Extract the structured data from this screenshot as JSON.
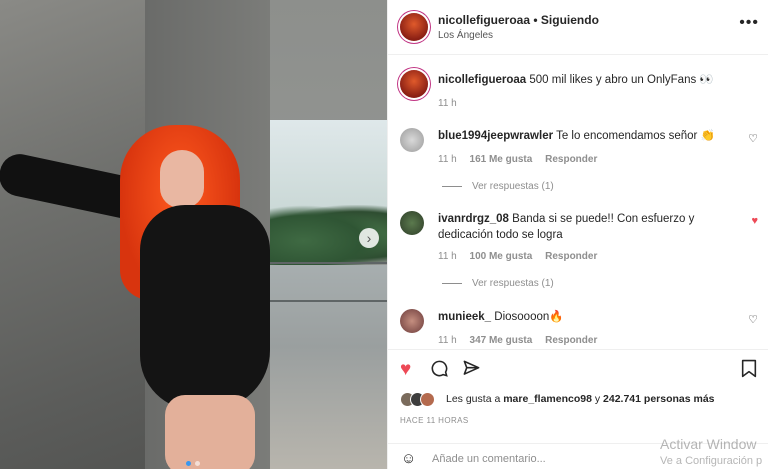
{
  "post": {
    "username": "nicollefigueroaa",
    "separator": "•",
    "follow_status": "Siguiendo",
    "location": "Los Ángeles",
    "more_icon": "more-horizontal-icon",
    "carousel_next_icon": "chevron-right-icon"
  },
  "caption": {
    "username": "nicollefigueroaa",
    "text": "500 mil likes y abro un OnlyFans 👀",
    "time": "11 h"
  },
  "comments": [
    {
      "username": "blue1994jeepwrawler",
      "text": "Te lo encomendamos señor 👏",
      "time": "11 h",
      "likes": "161 Me gusta",
      "reply": "Responder",
      "view_replies": "Ver respuestas (1)",
      "liked": false
    },
    {
      "username": "ivanrdrgz_08",
      "text": "Banda si se puede!! Con esfuerzo y dedicación todo se logra",
      "time": "11 h",
      "likes": "100 Me gusta",
      "reply": "Responder",
      "view_replies": "Ver respuestas (1)",
      "liked": true
    },
    {
      "username": "munieek_",
      "text": "Diosoooon🔥",
      "time": "11 h",
      "likes": "347 Me gusta",
      "reply": "Responder",
      "liked": false
    }
  ],
  "likes": {
    "prefix": "Les gusta a",
    "user": "mare_flamenco98",
    "connector": "y",
    "count": "242.741 personas más"
  },
  "posted_time": "HACE 11 HORAS",
  "add_comment_placeholder": "Añade un comentario...",
  "watermark": {
    "line1": "Activar Window",
    "line2": "Ve a Configuración p"
  },
  "colors": {
    "accent_like": "#ed4956",
    "text": "#262626",
    "muted": "#8e8e8e",
    "hair": "#ff5a1f"
  }
}
